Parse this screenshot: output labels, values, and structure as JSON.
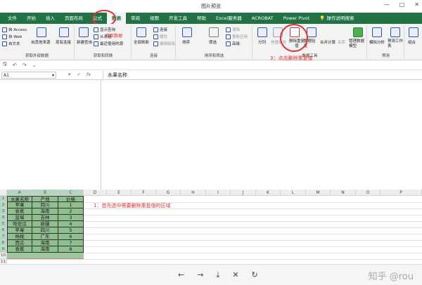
{
  "window": {
    "title": "图片预览",
    "controls": [
      "—",
      "□",
      "✕"
    ]
  },
  "tabs": [
    "文件",
    "开始",
    "插入",
    "页面布局",
    "公式",
    "数据",
    "审阅",
    "视图",
    "开发工具",
    "帮助",
    "Excel服务器",
    "ACROBAT",
    "Power Pivot",
    "操作说明搜索"
  ],
  "ribbon": {
    "get_external": {
      "items": [
        "自 Access",
        "自 Web",
        "自文本",
        "自其他来源",
        "现有连接"
      ],
      "name": "获取外部数据"
    },
    "get_transform": {
      "items": [
        "新建查询",
        "显示查询",
        "从表格",
        "最近使用的源"
      ],
      "name": "获取和转换"
    },
    "connections": {
      "items": [
        "全部刷新",
        "连接",
        "属性",
        "编辑链接"
      ],
      "name": "连接"
    },
    "sort_filter": {
      "items": [
        "排序",
        "筛选",
        "清除",
        "重新应用",
        "高级"
      ],
      "name": "排序和筛选"
    },
    "data_tools": {
      "items": [
        "分列",
        "快速填充",
        "删除重复值",
        "数据验证",
        "合并计算",
        "关系",
        "管理数据模型"
      ],
      "name": "数据工具"
    },
    "forecast": {
      "items": [
        "模拟分析",
        "预测工作表"
      ],
      "name": "预测"
    },
    "outline": {
      "items": [
        "组合"
      ]
    },
    "overlay_get_data": "获取数据"
  },
  "annotations": {
    "step1": "1：首先选中需要删除重复值的区域",
    "step3": "3：点击删除重复值"
  },
  "qat": {
    "save": "🖫",
    "undo": "↶",
    "redo": "↷",
    "more": "⌄"
  },
  "formula_bar": {
    "name_box": "A1",
    "name_box_arrow": "▾",
    "cancel": "✕",
    "enter": "✓",
    "fx": "fx",
    "value": "水果名称"
  },
  "columns": [
    "A",
    "B",
    "C",
    "D",
    "E",
    "F",
    "G",
    "H",
    "I",
    "J",
    "K",
    "L",
    "M",
    "N",
    "O",
    "P"
  ],
  "rows": [
    "1",
    "2",
    "3",
    "4",
    "5",
    "6",
    "7",
    "8",
    "9",
    "10",
    "11"
  ],
  "table": {
    "headers": [
      "水果名称",
      "产地",
      "价格"
    ],
    "rows": [
      [
        "苹果",
        "四川",
        "1"
      ],
      [
        "香蕉",
        "海南",
        "2"
      ],
      [
        "蓝莓",
        "吉林",
        "3"
      ],
      [
        "哈密瓜",
        "新疆",
        "4"
      ],
      [
        "苹果",
        "四川",
        "5"
      ],
      [
        "杨桃",
        "广东",
        "6"
      ],
      [
        "西瓜",
        "海南",
        "7"
      ],
      [
        "香蕉",
        "海南",
        "8"
      ]
    ]
  },
  "viewer_nav": [
    "←",
    "→",
    "⤓",
    "✕",
    "↻"
  ],
  "watermark": "知乎 @rou"
}
